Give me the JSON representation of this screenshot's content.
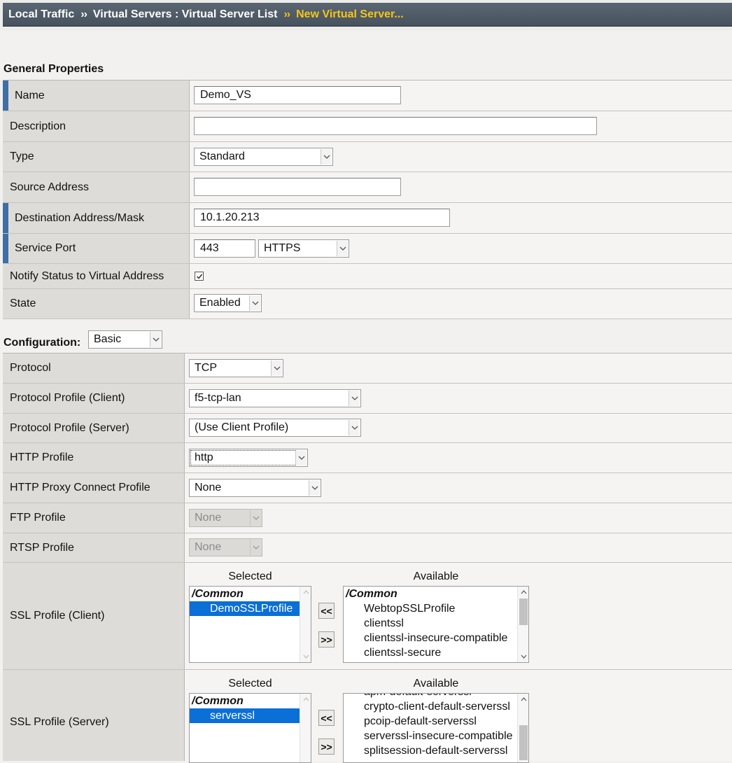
{
  "breadcrumb": {
    "items": [
      "Local Traffic",
      "Virtual Servers : Virtual Server List"
    ],
    "current": "New Virtual Server...",
    "separator": "››"
  },
  "general": {
    "title": "General Properties",
    "name": {
      "label": "Name",
      "value": "Demo_VS"
    },
    "description": {
      "label": "Description",
      "value": ""
    },
    "type": {
      "label": "Type",
      "value": "Standard"
    },
    "source_address": {
      "label": "Source Address",
      "value": ""
    },
    "destination": {
      "label": "Destination Address/Mask",
      "value": "10.1.20.213"
    },
    "service_port": {
      "label": "Service Port",
      "port": "443",
      "protocol": "HTTPS"
    },
    "notify": {
      "label": "Notify Status to Virtual Address",
      "checked": true
    },
    "state": {
      "label": "State",
      "value": "Enabled"
    }
  },
  "configuration": {
    "title": "Configuration:",
    "mode": "Basic",
    "protocol": {
      "label": "Protocol",
      "value": "TCP"
    },
    "profile_client": {
      "label": "Protocol Profile (Client)",
      "value": "f5-tcp-lan"
    },
    "profile_server": {
      "label": "Protocol Profile (Server)",
      "value": "(Use Client Profile)"
    },
    "http_profile": {
      "label": "HTTP Profile",
      "value": "http"
    },
    "http_proxy": {
      "label": "HTTP Proxy Connect Profile",
      "value": "None"
    },
    "ftp_profile": {
      "label": "FTP Profile",
      "value": "None"
    },
    "rtsp_profile": {
      "label": "RTSP Profile",
      "value": "None"
    },
    "ssl_client": {
      "label": "SSL Profile (Client)",
      "selected_header": "Selected",
      "available_header": "Available",
      "selected_group": "/Common",
      "selected_items": [
        "DemoSSLProfile"
      ],
      "available_group": "/Common",
      "available_items": [
        "WebtopSSLProfile",
        "clientssl",
        "clientssl-insecure-compatible",
        "clientssl-secure"
      ],
      "add_label": "<<",
      "remove_label": ">>"
    },
    "ssl_server": {
      "label": "SSL Profile (Server)",
      "selected_header": "Selected",
      "available_header": "Available",
      "selected_group": "/Common",
      "selected_items": [
        "serverssl"
      ],
      "available_items": [
        "apm-default-serverssl",
        "crypto-client-default-serverssl",
        "pcoip-default-serverssl",
        "serverssl-insecure-compatible",
        "splitsession-default-serverssl"
      ],
      "add_label": "<<",
      "remove_label": ">>"
    }
  },
  "colors": {
    "breadcrumb_bg": "#46525d",
    "breadcrumb_current": "#f5c518",
    "required_marker": "#3f6fa5",
    "label_bg": "#dedcd8",
    "selection_bg": "#0a6fd6"
  }
}
